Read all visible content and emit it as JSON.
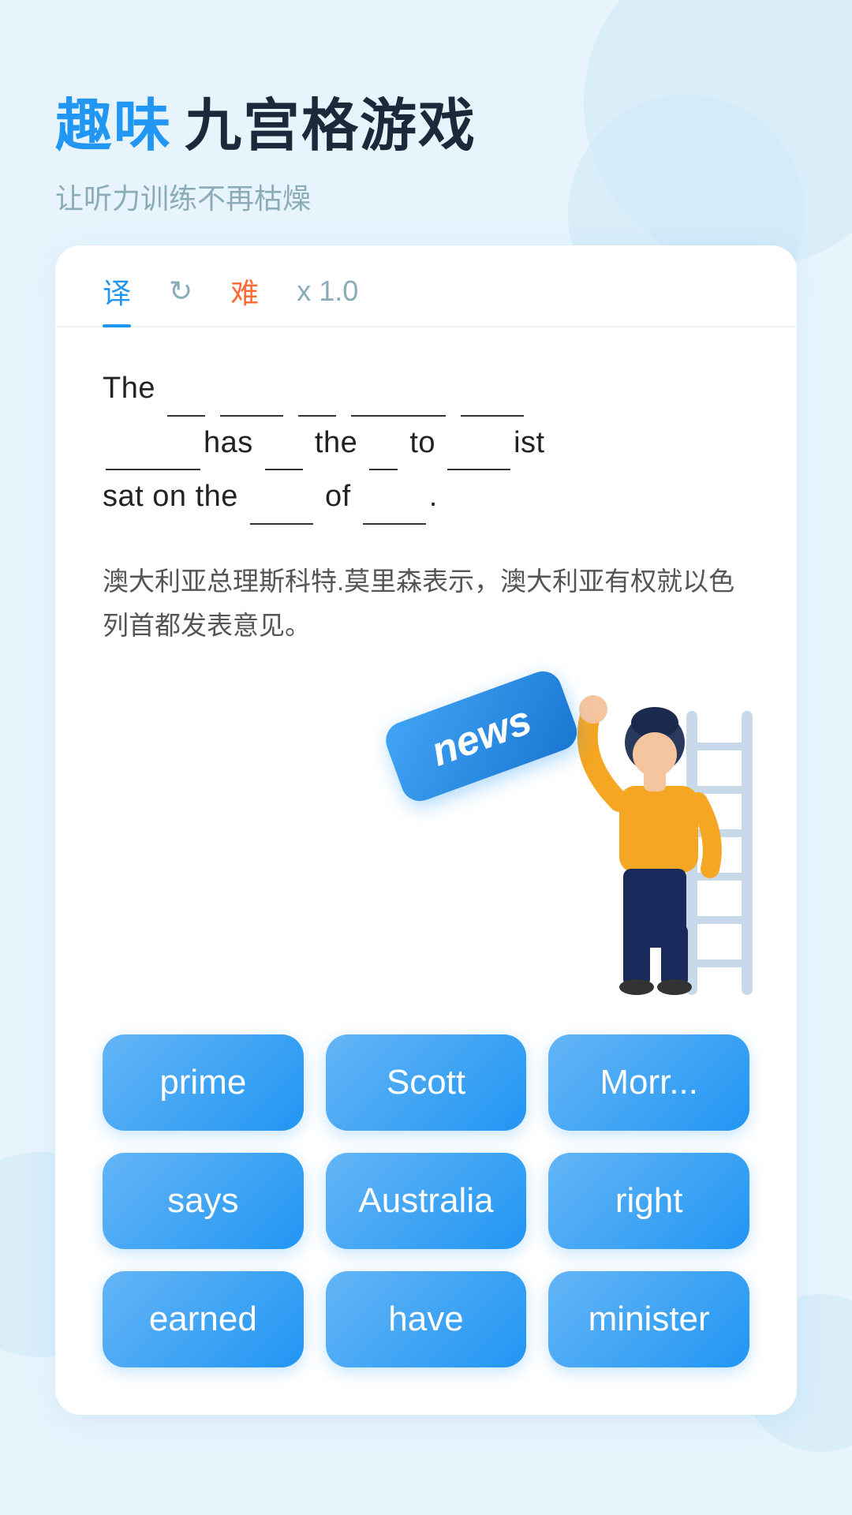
{
  "header": {
    "title_accent": "趣味",
    "title_main": "九宫格游戏",
    "subtitle": "让听力训练不再枯燥"
  },
  "tabs": [
    {
      "id": "translate",
      "label": "译",
      "active": true
    },
    {
      "id": "refresh",
      "label": "↻",
      "active": false
    },
    {
      "id": "difficulty",
      "label": "难",
      "active": false
    },
    {
      "id": "speed",
      "label": "x 1.0",
      "active": false
    }
  ],
  "sentence": {
    "text": "The ___ ______ ___ __________ _____ ________has ___ the ___ to _____ist sat on the ____ of _____.",
    "chinese": "澳大利亚总理斯科特.莫里森表示，澳大利亚有权就以色列首都发表意见。"
  },
  "news_badge": "news",
  "word_buttons": [
    {
      "id": "prime",
      "label": "prime"
    },
    {
      "id": "scott",
      "label": "Scott"
    },
    {
      "id": "morrison",
      "label": "Morr..."
    },
    {
      "id": "says",
      "label": "says"
    },
    {
      "id": "australia",
      "label": "Australia"
    },
    {
      "id": "right",
      "label": "right"
    },
    {
      "id": "earned",
      "label": "earned"
    },
    {
      "id": "have",
      "label": "have"
    },
    {
      "id": "minister",
      "label": "minister"
    }
  ]
}
